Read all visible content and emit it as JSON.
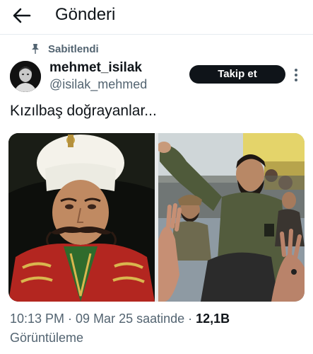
{
  "header": {
    "title": "Gönderi",
    "back_icon": "arrow-left-icon"
  },
  "pinned": {
    "label": "Sabitlendi",
    "icon": "pin-icon"
  },
  "author": {
    "display_name": "mehmet_isilak",
    "handle": "@isilak_mehmed"
  },
  "follow_button": {
    "label": "Takip et"
  },
  "more_icon": "vertical-ellipsis-icon",
  "tweet": {
    "text": "Kızılbaş doğrayanlar..."
  },
  "meta": {
    "timestamp": "10:13 PM · 09 Mar 25 saatinde",
    "separator": " · ",
    "view_count": "12,1B",
    "view_label": "Görüntüleme"
  },
  "colors": {
    "primary_text": "#0f1419",
    "secondary_text": "#536471",
    "button_bg": "#0f1419",
    "divider": "#e6ecf0"
  }
}
